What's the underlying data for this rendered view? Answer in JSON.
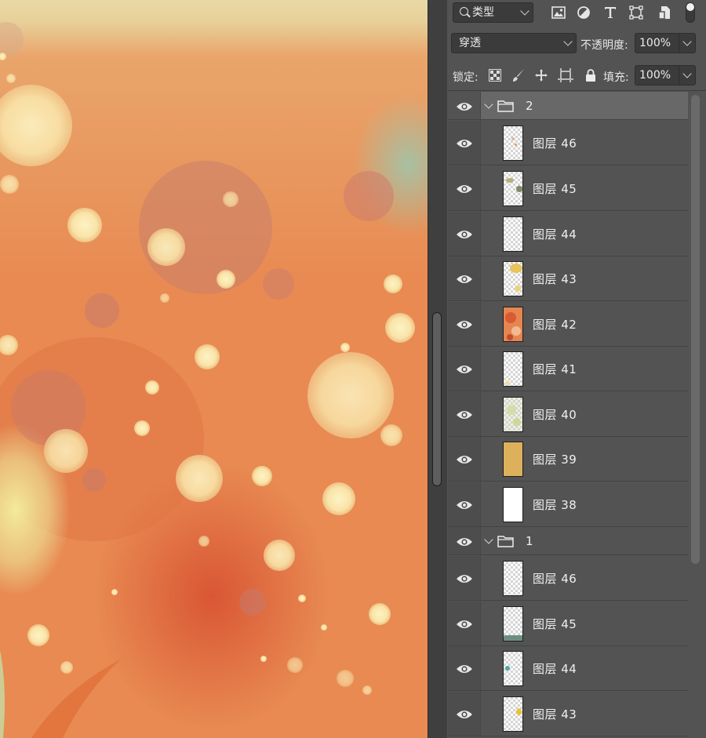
{
  "canvas": {
    "description_colors": {
      "base": "#e98a4f",
      "top": "#e9d6a0",
      "accent_teal": "#a8c9ae"
    }
  },
  "panel": {
    "filter": {
      "label": "类型",
      "icons": [
        "image-filter-icon",
        "adjustment-filter-icon",
        "type-filter-icon",
        "shape-filter-icon",
        "smart-object-filter-icon"
      ]
    },
    "blend_mode": "穿透",
    "opacity_label": "不透明度:",
    "opacity_value": "100%",
    "lock_label": "锁定:",
    "lock_icons": [
      "lock-transparent-icon",
      "lock-paint-icon",
      "lock-position-icon",
      "lock-artboard-icon",
      "lock-all-icon"
    ],
    "fill_label": "填充:",
    "fill_value": "100%"
  },
  "layers": {
    "groups": [
      {
        "name": "2",
        "selected": true,
        "items": [
          {
            "name": "图层 46",
            "thumb": "sparse"
          },
          {
            "name": "图层 45",
            "thumb": "olive"
          },
          {
            "name": "图层 44",
            "thumb": "empty"
          },
          {
            "name": "图层 43",
            "thumb": "yellow"
          },
          {
            "name": "图层 42",
            "thumb": "orange"
          },
          {
            "name": "图层 41",
            "thumb": "faint"
          },
          {
            "name": "图层 40",
            "thumb": "green-light"
          },
          {
            "name": "图层 39",
            "thumb": "solid-gold"
          },
          {
            "name": "图层 38",
            "thumb": "solid-white"
          }
        ]
      },
      {
        "name": "1",
        "selected": false,
        "items": [
          {
            "name": "图层 46",
            "thumb": "empty"
          },
          {
            "name": "图层 45",
            "thumb": "teal-bottom"
          },
          {
            "name": "图层 44",
            "thumb": "teal-dot"
          },
          {
            "name": "图层 43",
            "thumb": "yellow-dot"
          }
        ]
      }
    ]
  }
}
